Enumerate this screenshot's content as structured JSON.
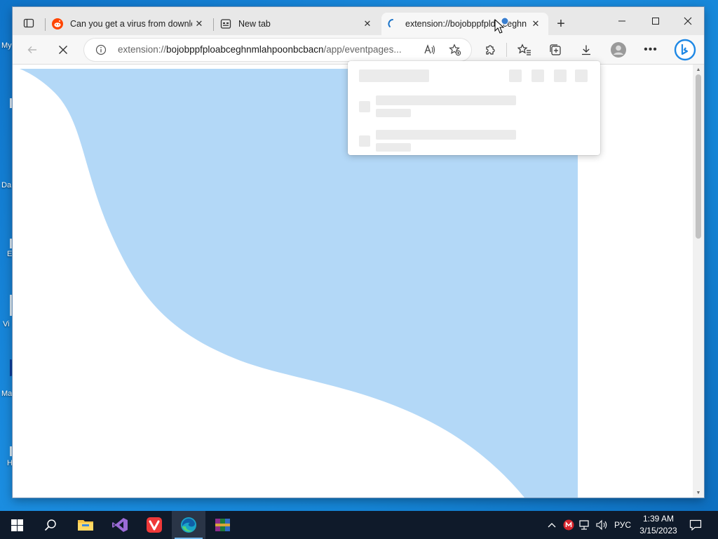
{
  "desktop": {
    "icon_labels": [
      "My",
      "Da",
      "E",
      "Vi",
      "Ma",
      "H"
    ]
  },
  "browser": {
    "tabs": [
      {
        "title": "Can you get a virus from downlo",
        "favicon": "reddit-icon",
        "active": false
      },
      {
        "title": "New tab",
        "favicon": "new-tab-icon",
        "active": false
      },
      {
        "title": "extension://bojobppfpld...ceghn",
        "favicon": "loading-spinner-icon",
        "active": true
      }
    ],
    "address": {
      "url_prefix": "extension://",
      "url_host": "bojobppfploabceghnmlahpoonbcbacn",
      "url_path": "/app/eventpages..."
    },
    "colors": {
      "page_shape": "#b3d8f7",
      "reddit": "#ff4500",
      "bing": "#1e88e5"
    }
  },
  "taskbar": {
    "apps": [
      "start-button",
      "search-icon",
      "file-explorer-icon",
      "visual-studio-icon",
      "vivaldi-icon",
      "edge-icon",
      "winrar-icon"
    ],
    "language": "РУС",
    "time": "1:39 AM",
    "date": "3/15/2023"
  }
}
